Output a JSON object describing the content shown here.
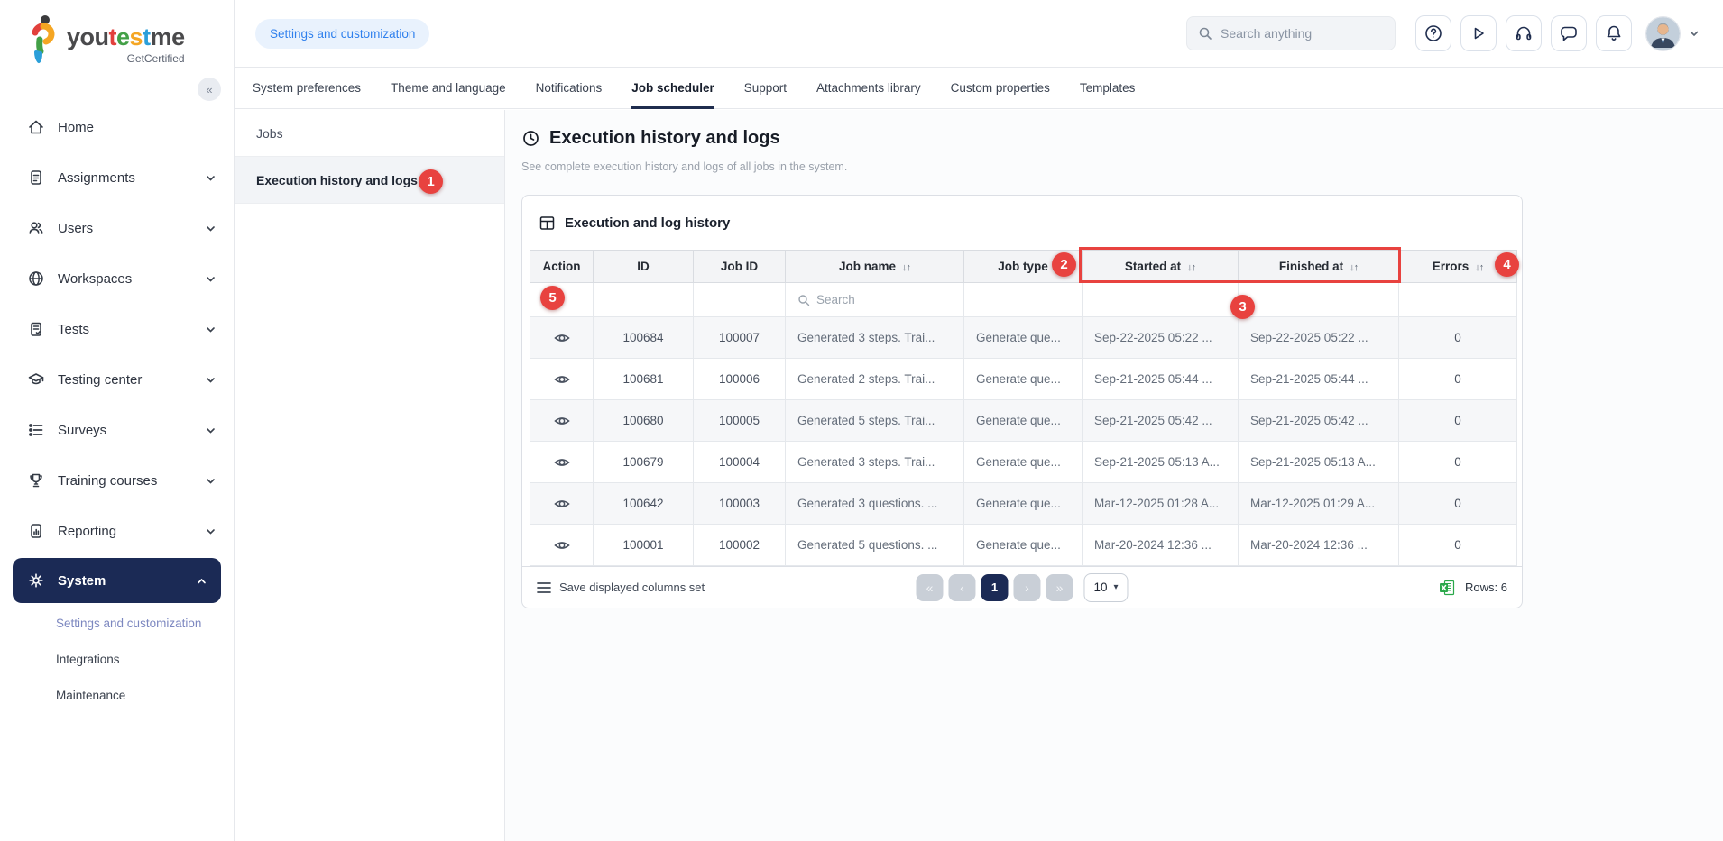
{
  "brand": {
    "segments": [
      {
        "text": "you",
        "color": "#4a4a4c"
      },
      {
        "text": "t",
        "color": "#e2403c"
      },
      {
        "text": "e",
        "color": "#43a047"
      },
      {
        "text": "s",
        "color": "#f5a623"
      },
      {
        "text": "t",
        "color": "#2b9fd9"
      },
      {
        "text": "me",
        "color": "#4a4a4c"
      }
    ],
    "tagline": "GetCertified",
    "collapse_glyph": "«"
  },
  "sidebar": {
    "items": [
      {
        "label": "Home",
        "icon": "home-icon",
        "chevron": "none"
      },
      {
        "label": "Assignments",
        "icon": "assignments-icon",
        "chevron": "down"
      },
      {
        "label": "Users",
        "icon": "users-icon",
        "chevron": "down"
      },
      {
        "label": "Workspaces",
        "icon": "globe-icon",
        "chevron": "down"
      },
      {
        "label": "Tests",
        "icon": "tests-icon",
        "chevron": "down"
      },
      {
        "label": "Testing center",
        "icon": "graduation-cap-icon",
        "chevron": "down"
      },
      {
        "label": "Surveys",
        "icon": "list-icon",
        "chevron": "down"
      },
      {
        "label": "Training courses",
        "icon": "trophy-icon",
        "chevron": "down"
      },
      {
        "label": "Reporting",
        "icon": "report-icon",
        "chevron": "down"
      },
      {
        "label": "System",
        "icon": "gear-icon",
        "chevron": "up",
        "selected": true
      }
    ],
    "subitems": [
      {
        "label": "Settings and customization",
        "selected": true
      },
      {
        "label": "Integrations",
        "selected": false
      },
      {
        "label": "Maintenance",
        "selected": false
      }
    ]
  },
  "topbar": {
    "chip": "Settings and customization",
    "search_placeholder": "Search anything"
  },
  "tabs": {
    "items": [
      "System preferences",
      "Theme and language",
      "Notifications",
      "Job scheduler",
      "Support",
      "Attachments library",
      "Custom properties",
      "Templates"
    ],
    "active": "Job scheduler"
  },
  "secnav": {
    "items": [
      {
        "label": "Jobs",
        "selected": false
      },
      {
        "label": "Execution history and logs",
        "selected": true
      }
    ]
  },
  "page": {
    "title": "Execution history and logs",
    "subtitle": "See complete execution history and logs of all jobs in the system."
  },
  "table": {
    "title": "Execution and log history",
    "columns": [
      {
        "label": "Action",
        "sortable": false
      },
      {
        "label": "ID",
        "sortable": false
      },
      {
        "label": "Job ID",
        "sortable": false
      },
      {
        "label": "Job name",
        "sortable": true
      },
      {
        "label": "Job type",
        "sortable": false
      },
      {
        "label": "Started at",
        "sortable": true
      },
      {
        "label": "Finished at",
        "sortable": true
      },
      {
        "label": "Errors",
        "sortable": true
      }
    ],
    "sort_glyph": "↓↑",
    "filter_search_placeholder": "Search",
    "rows": [
      {
        "id": "100684",
        "job_id": "100007",
        "job_name": "Generated 3 steps. Trai...",
        "job_type": "Generate que...",
        "started_at": "Sep-22-2025 05:22 ...",
        "finished_at": "Sep-22-2025 05:22 ...",
        "errors": "0"
      },
      {
        "id": "100681",
        "job_id": "100006",
        "job_name": "Generated 2 steps. Trai...",
        "job_type": "Generate que...",
        "started_at": "Sep-21-2025 05:44 ...",
        "finished_at": "Sep-21-2025 05:44 ...",
        "errors": "0"
      },
      {
        "id": "100680",
        "job_id": "100005",
        "job_name": "Generated 5 steps. Trai...",
        "job_type": "Generate que...",
        "started_at": "Sep-21-2025 05:42 ...",
        "finished_at": "Sep-21-2025 05:42 ...",
        "errors": "0"
      },
      {
        "id": "100679",
        "job_id": "100004",
        "job_name": "Generated 3 steps. Trai...",
        "job_type": "Generate que...",
        "started_at": "Sep-21-2025 05:13 A...",
        "finished_at": "Sep-21-2025 05:13 A...",
        "errors": "0"
      },
      {
        "id": "100642",
        "job_id": "100003",
        "job_name": "Generated 3 questions. ...",
        "job_type": "Generate que...",
        "started_at": "Mar-12-2025 01:28 A...",
        "finished_at": "Mar-12-2025 01:29 A...",
        "errors": "0"
      },
      {
        "id": "100001",
        "job_id": "100002",
        "job_name": "Generated 5 questions. ...",
        "job_type": "Generate que...",
        "started_at": "Mar-20-2024 12:36 ...",
        "finished_at": "Mar-20-2024 12:36 ...",
        "errors": "0"
      }
    ],
    "footer": {
      "save_columns_label": "Save displayed columns set",
      "pagination": {
        "first": "«",
        "prev": "‹",
        "page": "1",
        "next": "›",
        "last": "»"
      },
      "page_size": "10",
      "rows_label": "Rows: 6"
    }
  },
  "annotations": {
    "color": "#e8423f",
    "badges": [
      {
        "n": "1"
      },
      {
        "n": "2"
      },
      {
        "n": "3"
      },
      {
        "n": "4"
      },
      {
        "n": "5"
      }
    ]
  },
  "colors": {
    "accent_navy": "#1b2a55",
    "link_blue": "#2f80ed",
    "annotation_red": "#e8423f",
    "excel_green": "#2aa84a"
  }
}
